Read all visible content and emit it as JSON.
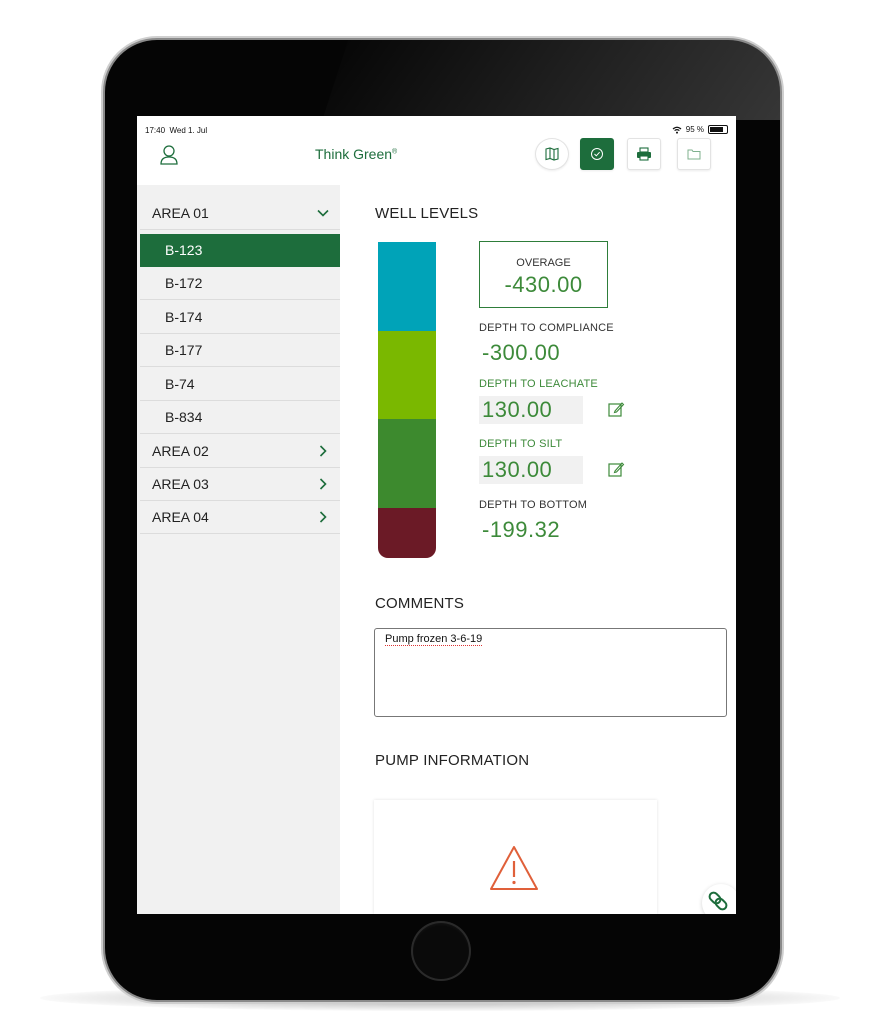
{
  "status_bar": {
    "time": "17:40",
    "date": "Wed 1. Jul",
    "battery": "95 %",
    "battery_level": 0.95
  },
  "header": {
    "brand": "Think Green",
    "brand_mark": "®",
    "buttons": [
      {
        "icon": "map-icon"
      },
      {
        "icon": "check-circle-icon",
        "active": true
      },
      {
        "icon": "print-icon"
      },
      {
        "icon": "folder-icon"
      }
    ]
  },
  "sidebar": {
    "areas": [
      {
        "label": "AREA 01",
        "expanded": true,
        "wells": [
          "B-123",
          "B-172",
          "B-174",
          "B-177",
          "B-74",
          "B-834"
        ],
        "selected_well": "B-123"
      },
      {
        "label": "AREA 02",
        "expanded": false
      },
      {
        "label": "AREA 03",
        "expanded": false
      },
      {
        "label": "AREA 04",
        "expanded": false
      }
    ],
    "add_label": "+"
  },
  "well_levels": {
    "title": "WELL LEVELS",
    "overage": {
      "label": "OVERAGE",
      "value": "-430.00"
    },
    "compliance": {
      "label": "DEPTH TO COMPLIANCE",
      "value": "-300.00"
    },
    "leachate": {
      "label": "DEPTH TO LEACHATE",
      "value": "130.00"
    },
    "silt": {
      "label": "DEPTH TO SILT",
      "value": "130.00"
    },
    "bottom": {
      "label": "DEPTH TO BOTTOM",
      "value": "-199.32"
    },
    "column_colors": [
      "#00a3b8",
      "#7ab800",
      "#3d8a2e",
      "#6b1a26"
    ]
  },
  "comments": {
    "title": "COMMENTS",
    "text": "Pump frozen 3-6-19"
  },
  "pump": {
    "title": "PUMP INFORMATION",
    "icon": "warning-icon"
  },
  "colors": {
    "brand_green": "#1d6d3c",
    "value_green": "#3d8a3a",
    "warning": "#e0603a"
  }
}
